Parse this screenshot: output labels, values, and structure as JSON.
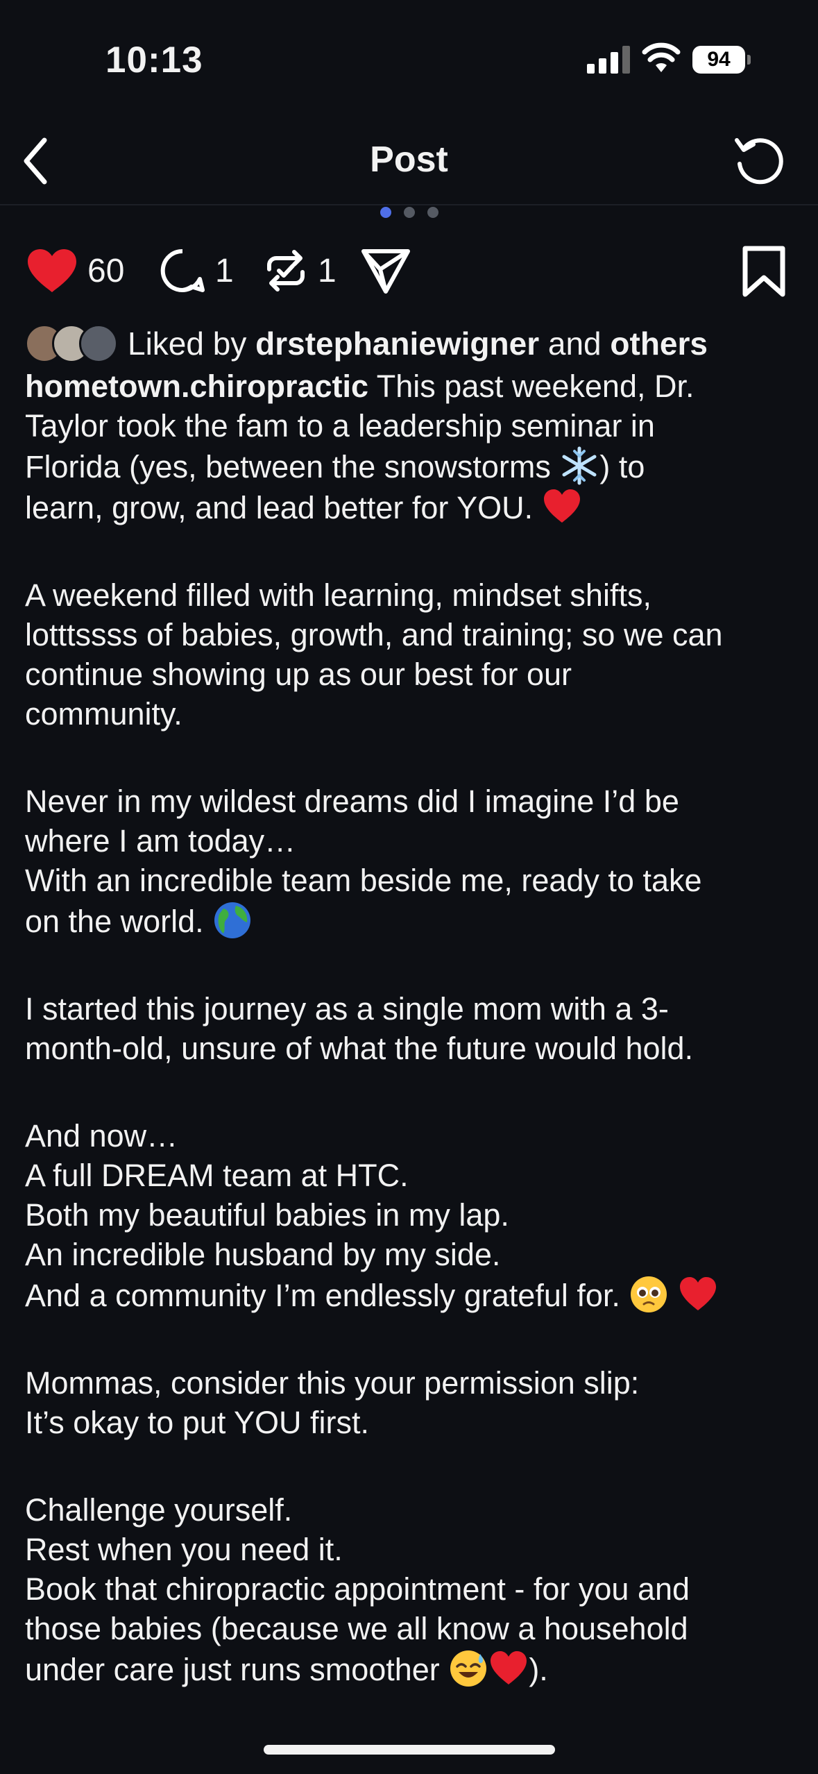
{
  "status_bar": {
    "time": "10:13",
    "battery": "94"
  },
  "nav": {
    "title": "Post"
  },
  "actions": {
    "likes": "60",
    "comments": "1",
    "reposts": "1"
  },
  "liked_by": {
    "prefix": "Liked by",
    "user": "drstephaniewigner",
    "connector": "and",
    "others": "others"
  },
  "caption": {
    "username": "hometown.chiropractic",
    "p1_l1": "This past weekend, Dr.",
    "p1_l2": "Taylor took the fam to a leadership seminar in",
    "p1_l3a": "Florida (yes, between the snowstorms",
    "p1_l3b": ") to",
    "p1_l4": "learn, grow, and lead better for YOU.",
    "p2_l1": "A weekend filled with learning, mindset shifts,",
    "p2_l2": "lotttssss of babies, growth, and training; so we can",
    "p2_l3": "continue showing up as our best for our",
    "p2_l4": "community.",
    "p3_l1": "Never in my wildest dreams did I imagine I’d be",
    "p3_l2": "where I am today…",
    "p3_l3": "With an incredible team beside me, ready to take",
    "p3_l4": "on the world.",
    "p4_l1": "I started this journey as a single mom with a 3-",
    "p4_l2": "month-old, unsure of what the future would hold.",
    "p5_l1": "And now…",
    "p5_l2": "A full DREAM team at HTC.",
    "p5_l3": "Both my beautiful babies in my lap.",
    "p5_l4": "An incredible husband by my side.",
    "p5_l5": "And a community I’m endlessly grateful for.",
    "p6_l1": "Mommas, consider this your permission slip:",
    "p6_l2": "It’s okay to put YOU first.",
    "p7_l1": "Challenge yourself.",
    "p7_l2": "Rest when you need it.",
    "p7_l3": "Book that chiropractic appointment - for you and",
    "p7_l4": "those babies (because we all know a household",
    "p7_l5a": "under care just runs smoother",
    "p7_l5b": ")."
  },
  "colors": {
    "background": "#0d0f14",
    "like_red": "#e8202e",
    "active_dot": "#4f6fe8"
  }
}
